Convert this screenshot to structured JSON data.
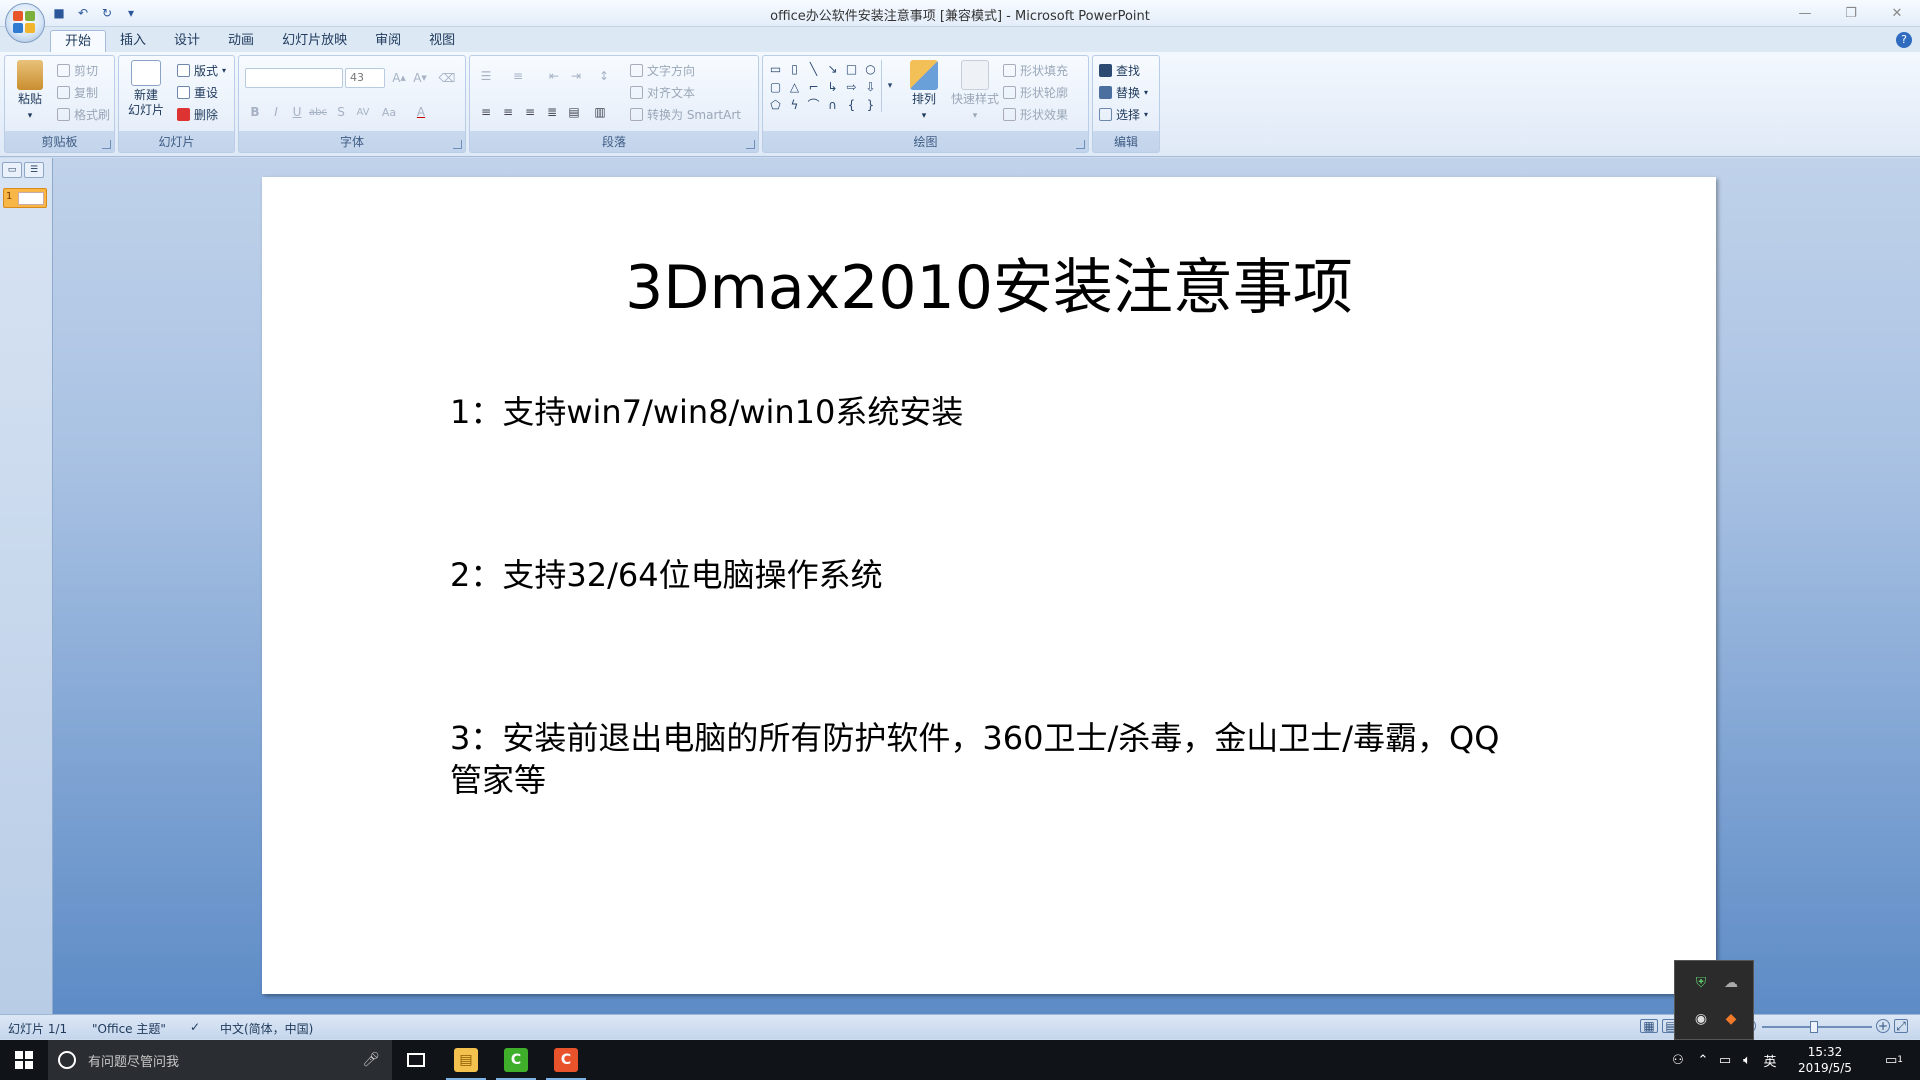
{
  "window": {
    "title": "office办公软件安装注意事项 [兼容模式] - Microsoft PowerPoint"
  },
  "tabs": [
    "开始",
    "插入",
    "设计",
    "动画",
    "幻灯片放映",
    "审阅",
    "视图"
  ],
  "active_tab": "开始",
  "ribbon": {
    "clipboard": {
      "label": "剪贴板",
      "paste": "粘贴",
      "cut": "剪切",
      "copy": "复制",
      "format_painter": "格式刷"
    },
    "slides": {
      "label": "幻灯片",
      "new_slide_line1": "新建",
      "new_slide_line2": "幻灯片",
      "layout": "版式",
      "reset": "重设",
      "delete": "删除"
    },
    "font": {
      "label": "字体",
      "font_name": "",
      "font_size": "43"
    },
    "paragraph": {
      "label": "段落",
      "text_direction": "文字方向",
      "align_text": "对齐文本",
      "convert_smartart": "转换为 SmartArt"
    },
    "drawing": {
      "label": "绘图",
      "arrange": "排列",
      "quick_styles": "快速样式",
      "shape_fill": "形状填充",
      "shape_outline": "形状轮廓",
      "shape_effects": "形状效果"
    },
    "editing": {
      "label": "编辑",
      "find": "查找",
      "replace": "替换",
      "select": "选择"
    }
  },
  "slide_panel": {
    "thumbnail_number": "1"
  },
  "slide": {
    "title": "3Dmax2010安装注意事项",
    "bullets": [
      "1：支持win7/win8/win10系统安装",
      "2：支持32/64位电脑操作系统",
      "3：安装前退出电脑的所有防护软件，360卫士/杀毒，金山卫士/毒霸，QQ管家等"
    ]
  },
  "statusbar": {
    "slide_counter": "幻灯片 1/1",
    "theme": "\"Office 主题\"",
    "language": "中文(简体，中国)"
  },
  "taskbar": {
    "search_placeholder": "有问题尽管问我",
    "ime": "英",
    "time": "15:32",
    "date": "2019/5/5",
    "notification_count": "1"
  },
  "colors": {
    "accent": "#2b579a",
    "workspace_top": "#c0d2ea",
    "workspace_bottom": "#5d8bc6",
    "thumb_selected": "#f7b646"
  }
}
